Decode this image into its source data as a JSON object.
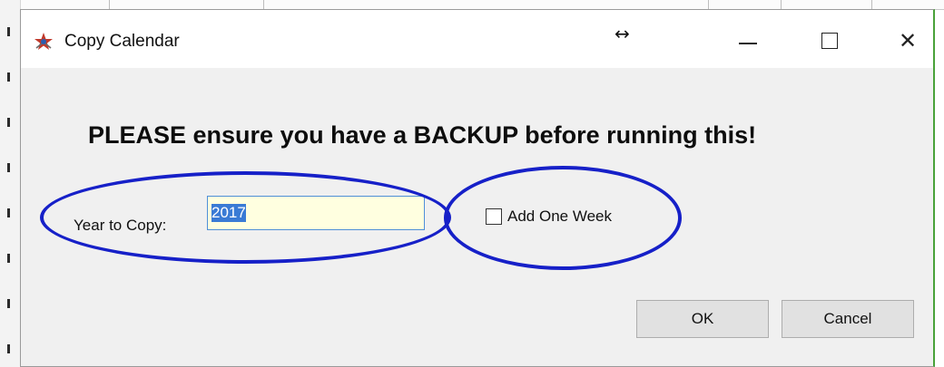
{
  "window": {
    "title": "Copy Calendar",
    "icon": "app-star-icon",
    "resize_cursor": "↔"
  },
  "content": {
    "warning": "PLEASE ensure you have a BACKUP before running this!",
    "year_label": "Year to Copy:",
    "year_value": "2017",
    "add_week_label": "Add One Week",
    "add_week_checked": false
  },
  "buttons": {
    "ok": "OK",
    "cancel": "Cancel"
  },
  "colors": {
    "annotation": "#1620c8",
    "input_border": "#4f8fd8",
    "input_bg": "#ffffe0",
    "selection": "#3a7bd5"
  }
}
